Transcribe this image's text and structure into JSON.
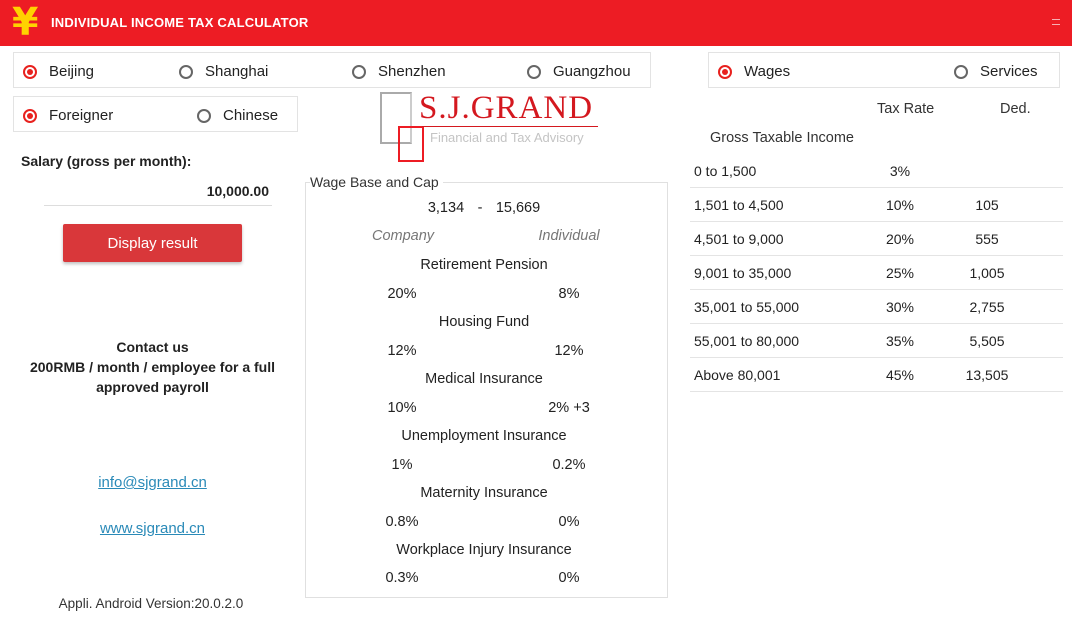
{
  "header": {
    "logo_glyph": "¥",
    "title": "INDIVIDUAL INCOME TAX CALCULATOR",
    "menu_icon": "overflow-menu-icon"
  },
  "colors": {
    "brand_red": "#ed1c24",
    "button_red": "#d9373a",
    "yen_yellow": "#ffd200",
    "link_blue": "#2a8ab8"
  },
  "cities": [
    {
      "label": "Beijing",
      "checked": true
    },
    {
      "label": "Shanghai",
      "checked": false
    },
    {
      "label": "Shenzhen",
      "checked": false
    },
    {
      "label": "Guangzhou",
      "checked": false
    }
  ],
  "nationality": [
    {
      "label": "Foreigner",
      "checked": true
    },
    {
      "label": "Chinese",
      "checked": false
    }
  ],
  "income_type": [
    {
      "label": "Wages",
      "checked": true
    },
    {
      "label": "Services",
      "checked": false
    }
  ],
  "salary": {
    "label": "Salary (gross per month):",
    "value": "10,000.00"
  },
  "display_button": "Display result",
  "contact": {
    "heading": "Contact us",
    "line1": "200RMB / month / employee for a full",
    "line2": "approved payroll",
    "email": "info@sjgrand.cn",
    "website": "www.sjgrand.cn"
  },
  "version": "Appli. Android Version:20.0.2.0",
  "logo": {
    "brand": "S.J.GRAND",
    "tagline": "Financial and Tax Advisory"
  },
  "wage_base": {
    "title": "Wage Base and Cap",
    "min": "3,134",
    "separator": "-",
    "max": "15,669",
    "company_label": "Company",
    "individual_label": "Individual",
    "items": [
      {
        "name": "Retirement Pension",
        "company": "20%",
        "individual": "8%"
      },
      {
        "name": "Housing Fund",
        "company": "12%",
        "individual": "12%"
      },
      {
        "name": "Medical Insurance",
        "company": "10%",
        "individual": "2% +3"
      },
      {
        "name": "Unemployment Insurance",
        "company": "1%",
        "individual": "0.2%"
      },
      {
        "name": "Maternity Insurance",
        "company": "0.8%",
        "individual": "0%"
      },
      {
        "name": "Workplace Injury Insurance",
        "company": "0.3%",
        "individual": "0%"
      }
    ]
  },
  "tax_table": {
    "rate_header": "Tax Rate",
    "ded_header": "Ded.",
    "income_header": "Gross Taxable Income",
    "rows": [
      {
        "range": "0 to 1,500",
        "rate": "3%",
        "ded": ""
      },
      {
        "range": "1,501 to 4,500",
        "rate": "10%",
        "ded": "105"
      },
      {
        "range": "4,501 to 9,000",
        "rate": "20%",
        "ded": "555"
      },
      {
        "range": "9,001 to 35,000",
        "rate": "25%",
        "ded": "1,005"
      },
      {
        "range": "35,001 to 55,000",
        "rate": "30%",
        "ded": "2,755"
      },
      {
        "range": "55,001 to 80,000",
        "rate": "35%",
        "ded": "5,505"
      },
      {
        "range": "Above 80,001",
        "rate": "45%",
        "ded": "13,505"
      }
    ]
  }
}
